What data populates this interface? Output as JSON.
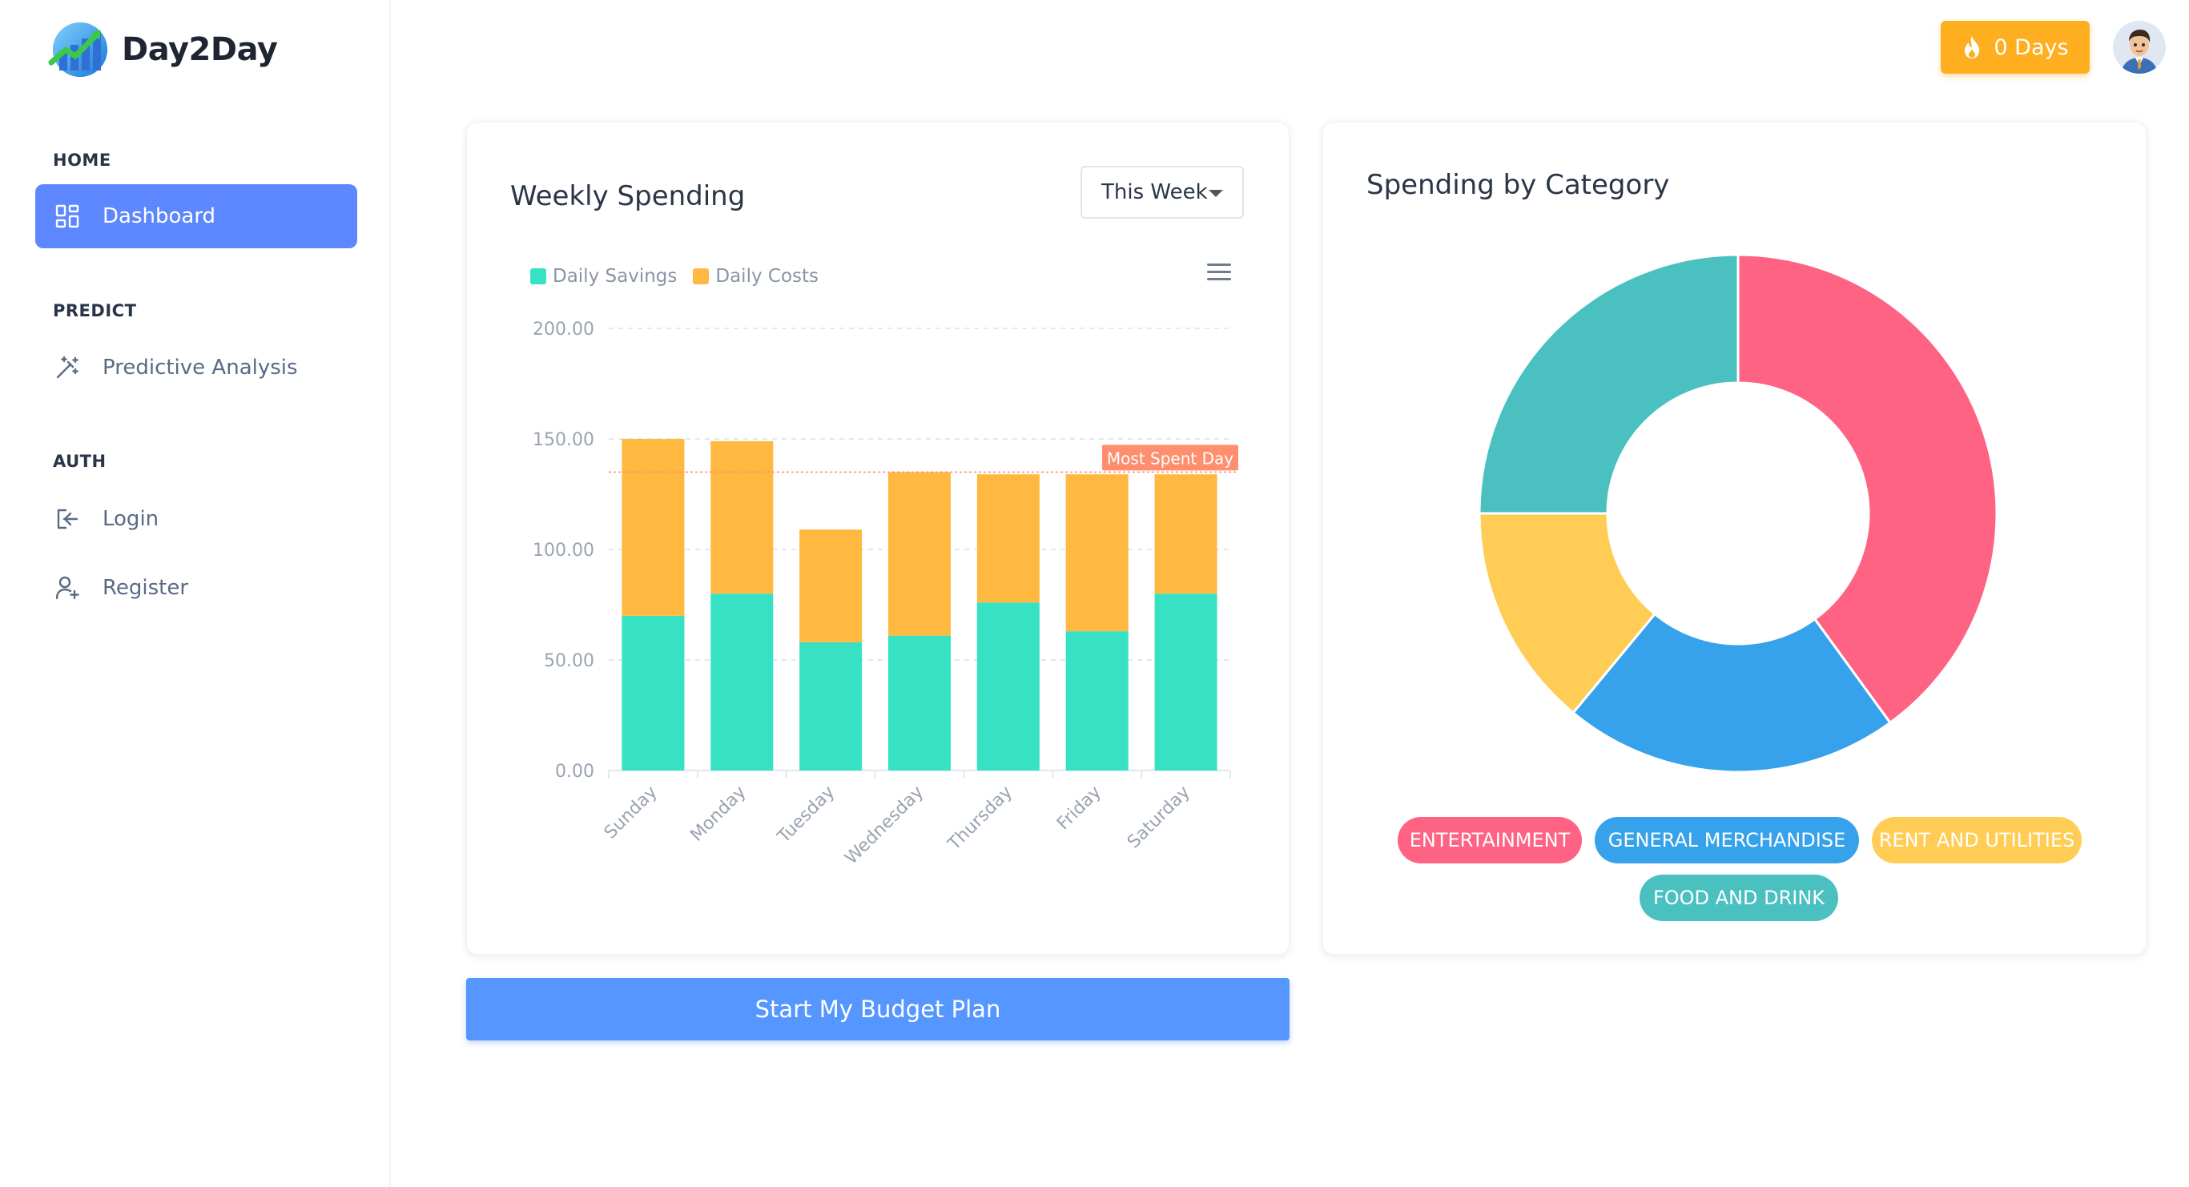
{
  "brand": {
    "name": "Day2Day"
  },
  "sidebar": {
    "sections": [
      {
        "caption": "HOME",
        "items": [
          {
            "label": "Dashboard",
            "icon": "dashboard-grid-icon",
            "active": true
          }
        ]
      },
      {
        "caption": "PREDICT",
        "items": [
          {
            "label": "Predictive Analysis",
            "icon": "magic-wand-icon",
            "active": false
          }
        ]
      },
      {
        "caption": "AUTH",
        "items": [
          {
            "label": "Login",
            "icon": "login-icon",
            "active": false
          },
          {
            "label": "Register",
            "icon": "user-plus-icon",
            "active": false
          }
        ]
      }
    ]
  },
  "header": {
    "streak_label": "0 Days",
    "streak_icon": "flame-icon",
    "avatar_icon": "user-avatar-icon"
  },
  "weekly_card": {
    "title": "Weekly Spending",
    "period_select": "This Week",
    "menu_icon": "hamburger-menu-icon",
    "annotation": "Most Spent Day"
  },
  "category_card": {
    "title": "Spending by Category"
  },
  "cta": {
    "label": "Start My Budget Plan"
  },
  "colors": {
    "accent": "#5d87ff",
    "savings": "#37e2c4",
    "costs": "#ffb840",
    "streak": "#ffae1f",
    "cta": "#5596ff",
    "entertainment": "#ff6384",
    "general_merchandise": "#36a2eb",
    "rent_and_utilities": "#ffcd56",
    "food_and_drink": "#4bc0c0"
  },
  "chart_data": [
    {
      "type": "bar",
      "stacked": true,
      "categories": [
        "Sunday",
        "Monday",
        "Tuesday",
        "Wednesday",
        "Thursday",
        "Friday",
        "Saturday"
      ],
      "series": [
        {
          "name": "Daily Savings",
          "values": [
            70,
            80,
            58,
            61,
            76,
            63,
            80
          ]
        },
        {
          "name": "Daily Costs",
          "values": [
            80,
            69,
            51,
            74,
            58,
            71,
            54
          ]
        }
      ],
      "y_ticks": [
        "0.00",
        "50.00",
        "100.00",
        "150.00",
        "200.00"
      ],
      "ylim": [
        0,
        200
      ],
      "reference_line": {
        "y": 135,
        "label": "Most Spent Day"
      },
      "legend": "top-left",
      "grid": true
    },
    {
      "type": "pie",
      "donut": true,
      "labels": [
        "ENTERTAINMENT",
        "GENERAL MERCHANDISE",
        "RENT AND UTILITIES",
        "FOOD AND DRINK"
      ],
      "values": [
        40,
        21,
        14,
        25
      ],
      "legend": "bottom"
    }
  ]
}
